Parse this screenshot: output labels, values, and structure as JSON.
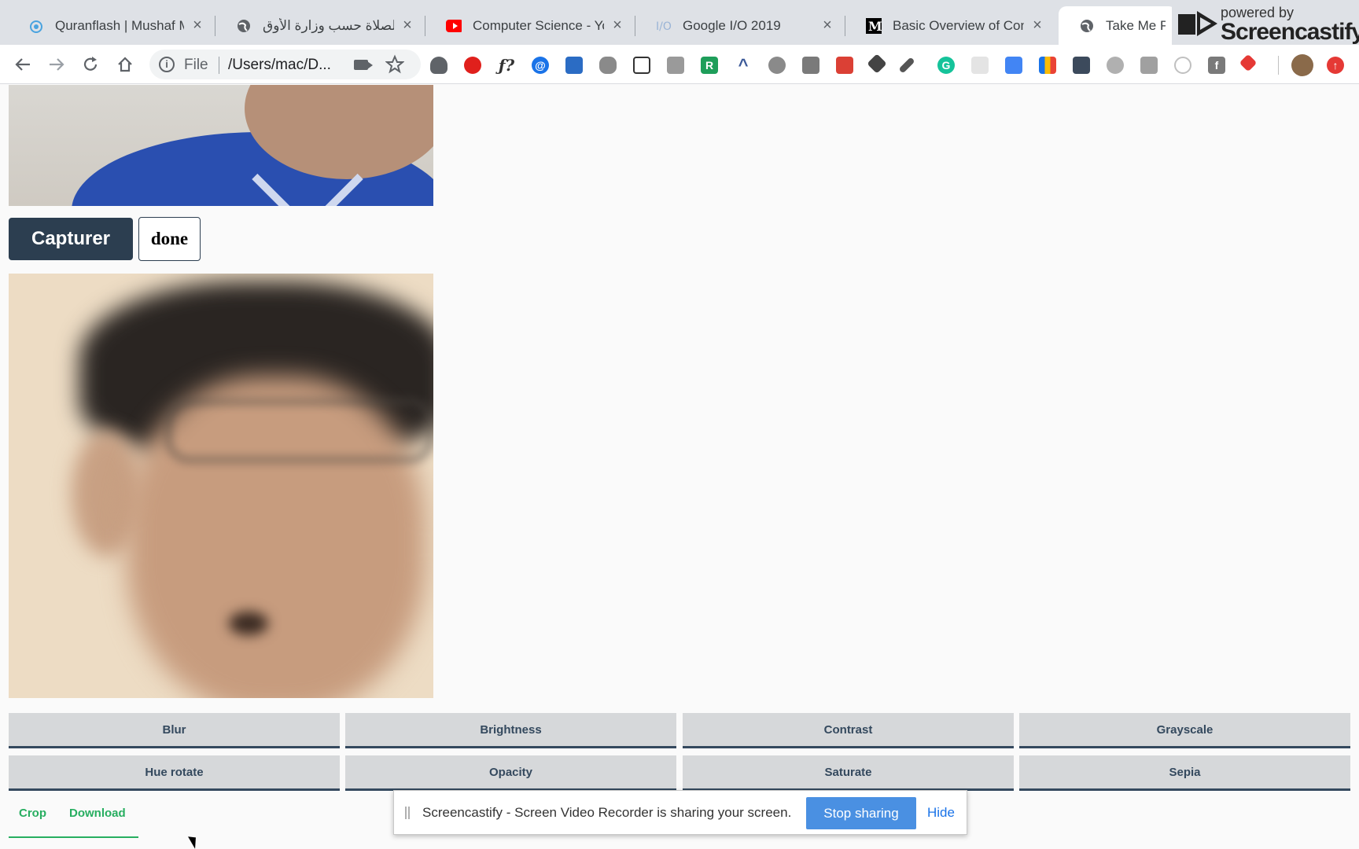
{
  "tabs": [
    {
      "title": "Quranflash | Mushaf Me",
      "icon": "quranflash-icon"
    },
    {
      "title": "مواقيت الصلاة حسب وزارة الأوق",
      "icon": "globe-icon"
    },
    {
      "title": "Computer Science - You",
      "icon": "youtube-icon"
    },
    {
      "title": "Google I/O 2019",
      "icon": "google-io-icon"
    },
    {
      "title": "Basic Overview of Conv",
      "icon": "medium-icon"
    },
    {
      "title": "Take Me Phot",
      "icon": "globe-icon"
    }
  ],
  "tab_close_glyph": "×",
  "screencastify": {
    "powered_by": "powered by",
    "name": "Screencastify"
  },
  "address": {
    "scheme": "File",
    "url": "/Users/mac/D..."
  },
  "extension_badge": "R",
  "page": {
    "capture_label": "Capturer",
    "done_label": "done",
    "filters": [
      "Blur",
      "Brightness",
      "Contrast",
      "Grayscale",
      "Hue rotate",
      "Opacity",
      "Saturate",
      "Sepia"
    ],
    "tabs": [
      "Crop",
      "Download"
    ]
  },
  "share_bar": {
    "message": "Screencastify - Screen Video Recorder is sharing your screen.",
    "stop_label": "Stop sharing",
    "hide_label": "Hide"
  },
  "colors": {
    "capture_bg": "#2c3e50",
    "filter_text": "#34495e",
    "tab_accent": "#27ae60",
    "stop_button": "#4a90e2"
  }
}
